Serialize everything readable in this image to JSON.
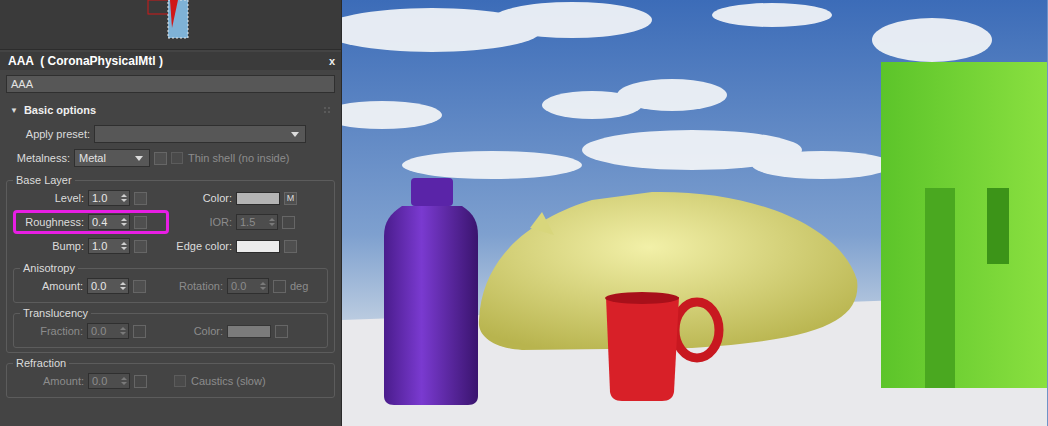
{
  "editor": {
    "title": "AAA  ( CoronaPhysicalMtl )",
    "close": "x",
    "name": "AAA"
  },
  "rollout": {
    "label": "Basic options",
    "expanded": true,
    "toggle": "▼"
  },
  "preset": {
    "label": "Apply preset:",
    "value": ""
  },
  "metalness": {
    "label": "Metalness:",
    "value": "Metal",
    "thin_shell": {
      "label": "Thin shell (no inside)",
      "checked": false,
      "disabled": true
    }
  },
  "base_layer": {
    "title": "Base Layer",
    "rows": [
      {
        "left": {
          "kind": "spinner",
          "label": "Level:",
          "value": "1.0",
          "disabled": false,
          "highlighted": false
        },
        "right": {
          "kind": "color",
          "label": "Color:",
          "swatch": "#b4b4b4",
          "map": "M",
          "disabled": false
        }
      },
      {
        "left": {
          "kind": "spinner",
          "label": "Roughness:",
          "value": "0.4",
          "disabled": false,
          "highlighted": true
        },
        "right": {
          "kind": "spinner",
          "label": "IOR:",
          "value": "1.5",
          "disabled": true,
          "highlighted": false
        }
      },
      {
        "left": {
          "kind": "spinner",
          "label": "Bump:",
          "value": "1.0",
          "disabled": false,
          "highlighted": false
        },
        "right": {
          "kind": "color",
          "label": "Edge color:",
          "swatch": "#ececec",
          "map": "",
          "disabled": false
        }
      }
    ],
    "subgroups": [
      {
        "title": "Anisotropy",
        "rows": [
          {
            "left": {
              "kind": "spinner",
              "label": "Amount:",
              "value": "0.0",
              "disabled": false,
              "highlighted": false
            },
            "right": {
              "kind": "spinner",
              "label": "Rotation:",
              "value": "0.0",
              "unit": "deg",
              "disabled": true,
              "highlighted": false
            }
          }
        ]
      },
      {
        "title": "Translucency",
        "rows": [
          {
            "left": {
              "kind": "spinner",
              "label": "Fraction:",
              "value": "0.0",
              "disabled": true,
              "highlighted": false
            },
            "right": {
              "kind": "color",
              "label": "Color:",
              "swatch": "#a9a9a9",
              "map": "",
              "disabled": true
            }
          }
        ]
      }
    ]
  },
  "refraction": {
    "title": "Refraction",
    "rows": [
      {
        "left": {
          "kind": "spinner",
          "label": "Amount:",
          "value": "0.0",
          "disabled": true,
          "highlighted": false
        },
        "right": {
          "kind": "checkbox",
          "label": "Caustics (slow)",
          "checked": false,
          "disabled": true
        }
      }
    ]
  }
}
